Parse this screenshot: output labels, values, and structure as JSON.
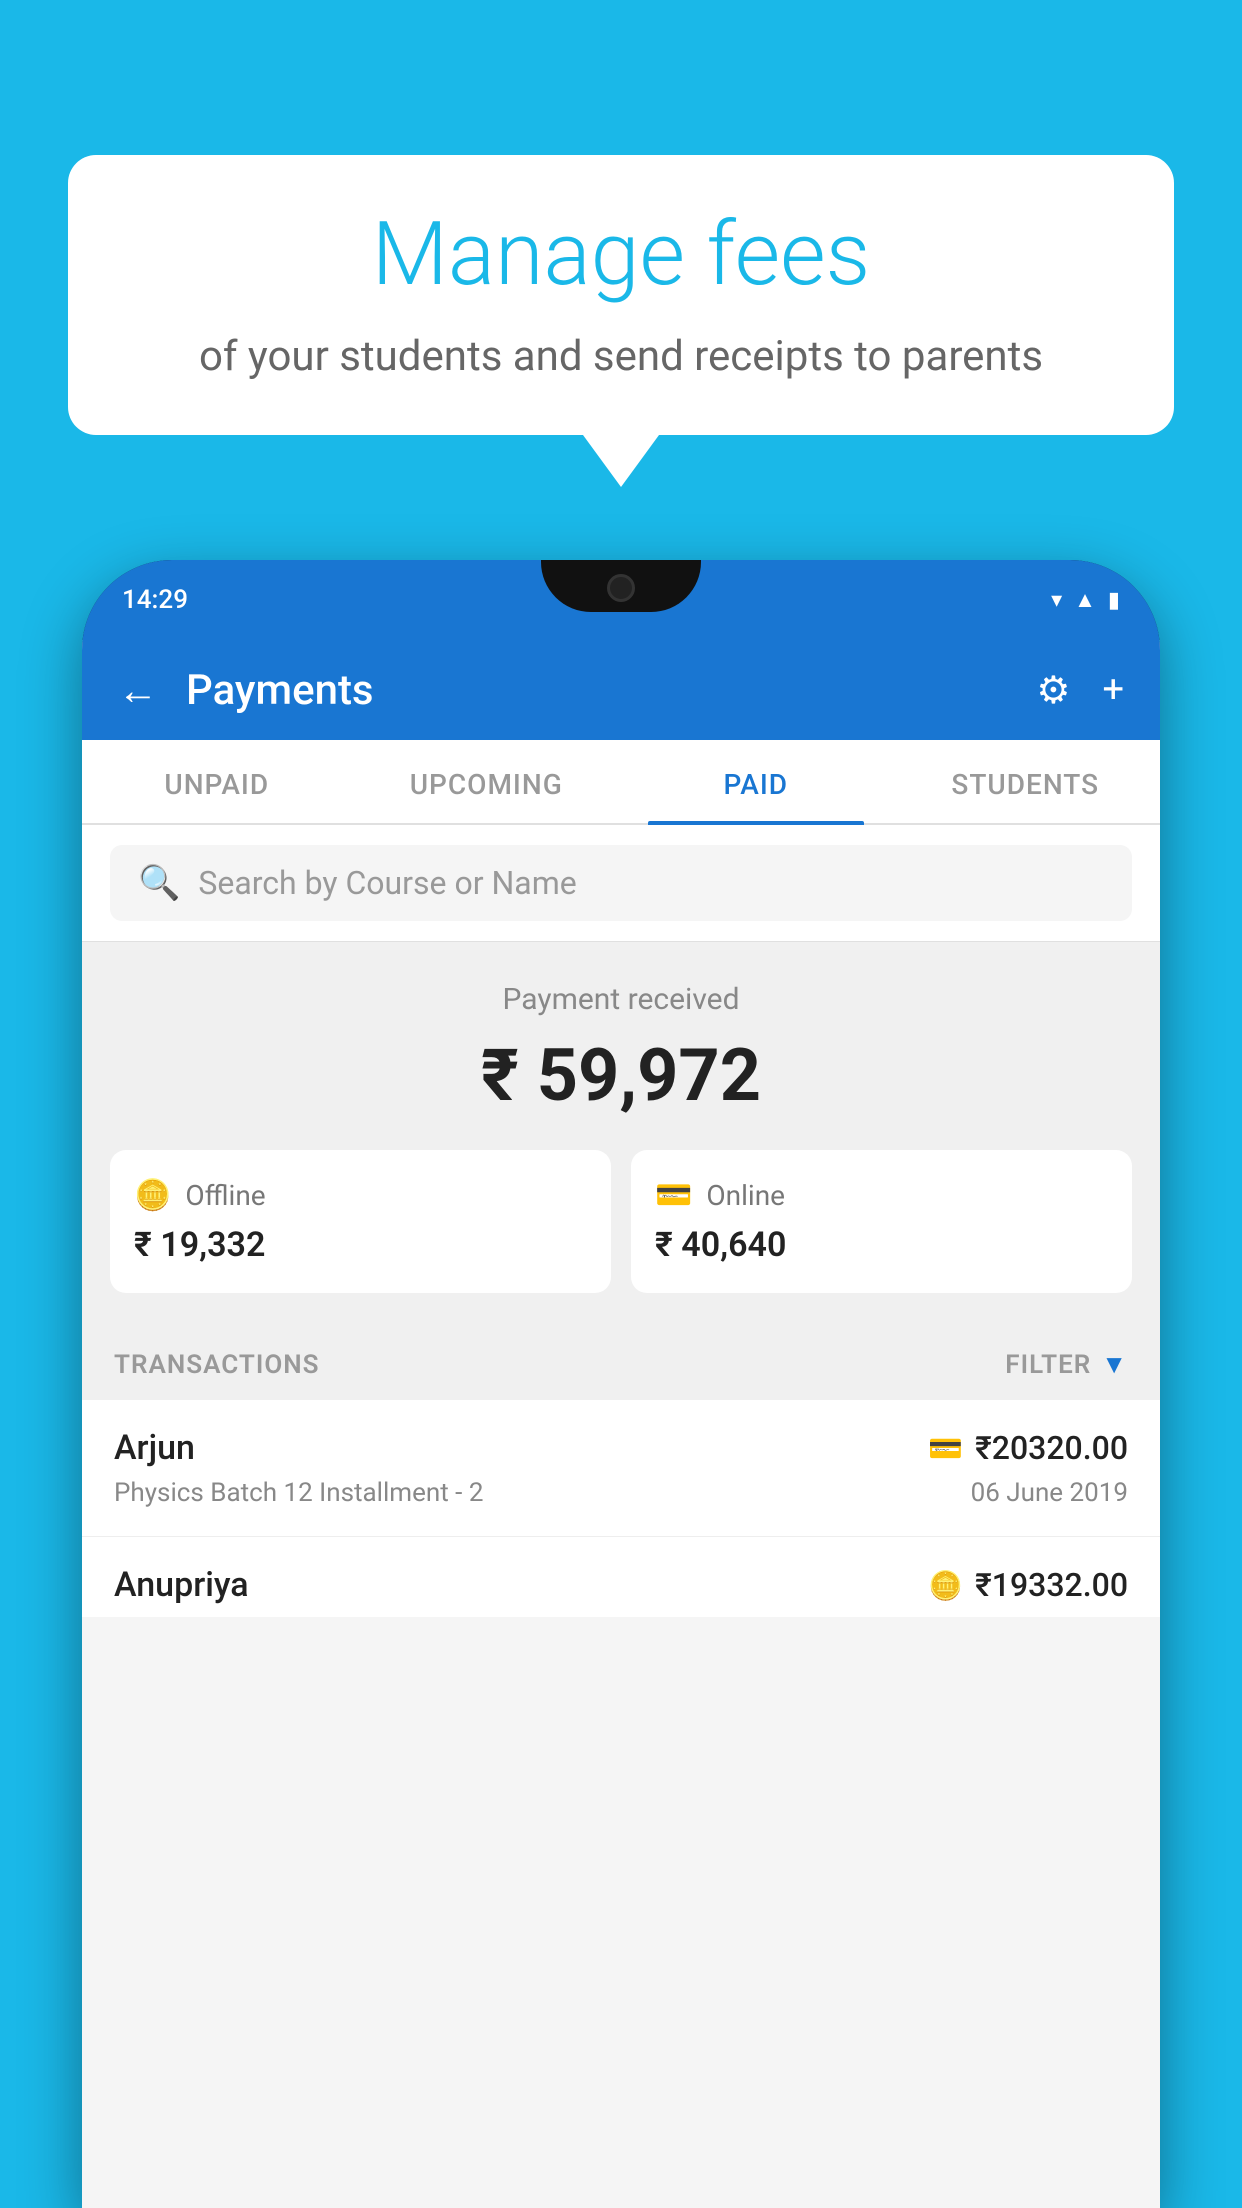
{
  "background_color": "#1ab8e8",
  "speech_bubble": {
    "title": "Manage fees",
    "subtitle": "of your students and send receipts to parents"
  },
  "status_bar": {
    "time": "14:29",
    "icons": [
      "wifi",
      "signal",
      "battery"
    ]
  },
  "header": {
    "title": "Payments",
    "back_label": "←",
    "settings_label": "⚙",
    "add_label": "+"
  },
  "tabs": [
    {
      "label": "UNPAID",
      "active": false
    },
    {
      "label": "UPCOMING",
      "active": false
    },
    {
      "label": "PAID",
      "active": true
    },
    {
      "label": "STUDENTS",
      "active": false
    }
  ],
  "search": {
    "placeholder": "Search by Course or Name"
  },
  "payment_summary": {
    "label": "Payment received",
    "total": "₹ 59,972",
    "offline_label": "Offline",
    "offline_amount": "₹ 19,332",
    "online_label": "Online",
    "online_amount": "₹ 40,640"
  },
  "transactions_section": {
    "header_label": "TRANSACTIONS",
    "filter_label": "FILTER"
  },
  "transactions": [
    {
      "name": "Arjun",
      "type_icon": "card",
      "amount": "₹20320.00",
      "detail": "Physics Batch 12 Installment - 2",
      "date": "06 June 2019"
    },
    {
      "name": "Anupriya",
      "type_icon": "cash",
      "amount": "₹19332.00",
      "detail": "",
      "date": ""
    }
  ]
}
